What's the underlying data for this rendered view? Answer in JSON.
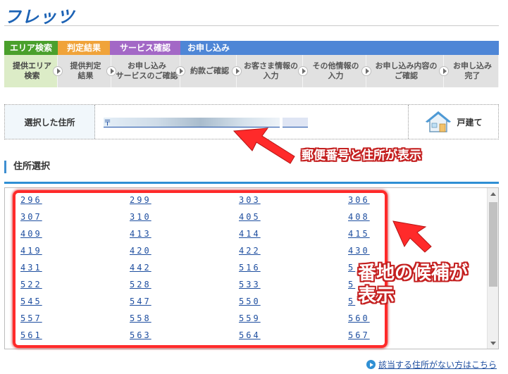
{
  "brand": {
    "logo": "フレッツ"
  },
  "phases": [
    {
      "label": "エリア検索",
      "color": "#4aa02c"
    },
    {
      "label": "判定結果",
      "color": "#f0a33a"
    },
    {
      "label": "サービス確認",
      "color": "#a368c6"
    },
    {
      "label": "お申し込み",
      "color": "#4e86d6"
    }
  ],
  "steps": [
    {
      "line1": "提供エリア",
      "line2": "検索"
    },
    {
      "line1": "提供判定",
      "line2": "結果"
    },
    {
      "line1": "お申し込み",
      "line2": "サービスのご確認"
    },
    {
      "line1": "約款ご確認",
      "line2": ""
    },
    {
      "line1": "お客さま情報の",
      "line2": "入力"
    },
    {
      "line1": "その他情報の",
      "line2": "入力"
    },
    {
      "line1": "お申し込み内容の",
      "line2": "ご確認"
    },
    {
      "line1": "お申し込み",
      "line2": "完了"
    }
  ],
  "selected_address": {
    "label": "選択した住所",
    "value_prefix": "〒",
    "dwelling_type": "戸建て"
  },
  "section": {
    "title": "住所選択"
  },
  "address_numbers": [
    "296",
    "299",
    "303",
    "306",
    "307",
    "310",
    "405",
    "408",
    "409",
    "413",
    "414",
    "415",
    "419",
    "420",
    "422",
    "430",
    "431",
    "442",
    "516",
    "5",
    "522",
    "528",
    "533",
    "5",
    "545",
    "547",
    "550",
    "5",
    "557",
    "558",
    "559",
    "560",
    "561",
    "563",
    "564",
    "567"
  ],
  "annotations": {
    "postal_note": "郵便番号と住所が表示",
    "candidates_line1": "番地の候補が",
    "candidates_line2": "表示"
  },
  "footer": {
    "no_match_link": "該当する住所がない方はこちら"
  },
  "colors": {
    "accent": "#2f8fd4",
    "link": "#1f4fa0",
    "highlight": "#ff2a2a"
  }
}
